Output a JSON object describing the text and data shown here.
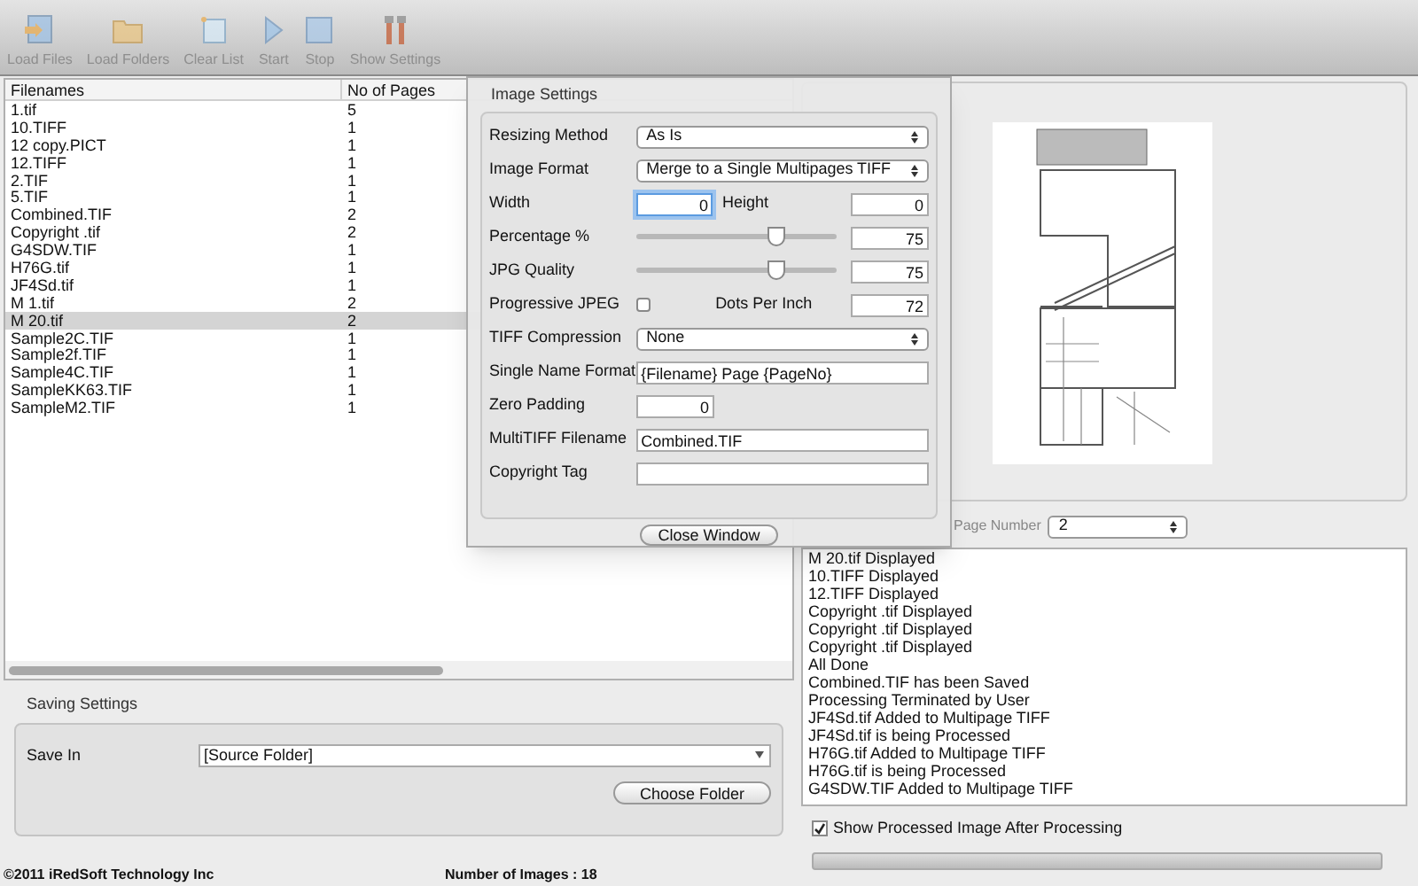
{
  "toolbar": [
    {
      "label": "Load Files",
      "kind": "load-files",
      "disabled": true
    },
    {
      "label": "Load Folders",
      "kind": "folder",
      "disabled": true
    },
    {
      "label": "Clear List",
      "kind": "clear",
      "disabled": true
    },
    {
      "label": "Start",
      "kind": "start",
      "disabled": true
    },
    {
      "label": "Stop",
      "kind": "stop",
      "disabled": true
    },
    {
      "label": "Show Settings",
      "kind": "tools",
      "disabled": true
    }
  ],
  "file_list": {
    "columns": [
      "Filenames",
      "No of Pages"
    ],
    "rows": [
      {
        "cells": [
          "1.tif",
          "5"
        ],
        "selected": false
      },
      {
        "cells": [
          "10.TIFF",
          "1"
        ],
        "selected": false
      },
      {
        "cells": [
          "12 copy.PICT",
          "1"
        ],
        "selected": false
      },
      {
        "cells": [
          "12.TIFF",
          "1"
        ],
        "selected": false
      },
      {
        "cells": [
          "2.TIF",
          "1"
        ],
        "selected": false
      },
      {
        "cells": [
          "5.TIF",
          "1"
        ],
        "selected": false
      },
      {
        "cells": [
          "Combined.TIF",
          "2"
        ],
        "selected": false
      },
      {
        "cells": [
          "Copyright .tif",
          "2"
        ],
        "selected": false
      },
      {
        "cells": [
          "G4SDW.TIF",
          "1"
        ],
        "selected": false
      },
      {
        "cells": [
          "H76G.tif",
          "1"
        ],
        "selected": false
      },
      {
        "cells": [
          "JF4Sd.tif",
          "1"
        ],
        "selected": false
      },
      {
        "cells": [
          "M 1.tif",
          "2"
        ],
        "selected": false
      },
      {
        "cells": [
          "M 20.tif",
          "2"
        ],
        "selected": true
      },
      {
        "cells": [
          "Sample2C.TIF",
          "1"
        ],
        "selected": false
      },
      {
        "cells": [
          "Sample2f.TIF",
          "1"
        ],
        "selected": false
      },
      {
        "cells": [
          "Sample4C.TIF",
          "1"
        ],
        "selected": false
      },
      {
        "cells": [
          "SampleKK63.TIF",
          "1"
        ],
        "selected": false
      },
      {
        "cells": [
          "SampleM2.TIF",
          "1"
        ],
        "selected": false
      }
    ]
  },
  "saving_settings": {
    "title": "Saving Settings",
    "save_in_label": "Save In",
    "save_in_value": "[Source Folder]",
    "choose_button": "Choose Folder"
  },
  "footer": {
    "copyright": "©2011 iRedSoft Technology Inc",
    "count": "Number of Images : 18"
  },
  "image_settings": {
    "title": "Image Settings",
    "rows": [
      {
        "kind": "select",
        "label": "Resizing Method",
        "value": "As Is"
      },
      {
        "kind": "select",
        "label": "Image Format",
        "value": "Merge to a Single Multipages TIFF"
      },
      {
        "kind": "pair",
        "label": "Width",
        "value": "0",
        "label2": "Height",
        "value2": "0",
        "focused": true
      },
      {
        "kind": "slider",
        "label": "Percentage %",
        "level": 0.72,
        "value": "75"
      },
      {
        "kind": "slider",
        "label": "JPG Quality",
        "level": 0.72,
        "value": "75"
      },
      {
        "kind": "check",
        "label": "Progressive JPEG",
        "checked": false,
        "label2": "Dots Per Inch",
        "value2": "72"
      },
      {
        "kind": "select",
        "label": "TIFF Compression",
        "value": "None"
      },
      {
        "kind": "text",
        "label": "Single Name Format",
        "value": "{Filename} Page {PageNo}"
      },
      {
        "kind": "short",
        "label": "Zero Padding",
        "value": "0"
      },
      {
        "kind": "text",
        "label": "MultiTIFF Filename",
        "value": "Combined.TIF"
      },
      {
        "kind": "text",
        "label": "Copyright Tag",
        "value": ""
      }
    ],
    "close_button": "Close Window"
  },
  "preview": {
    "page_number_label": "Page Number",
    "page_number": "2"
  },
  "log": [
    "M 20.tif Displayed",
    "10.TIFF Displayed",
    "12.TIFF Displayed",
    "Copyright .tif Displayed",
    "Copyright .tif Displayed",
    "Copyright .tif Displayed",
    "All Done",
    "Combined.TIF has been Saved",
    "Processing Terminated by User",
    "JF4Sd.tif Added to Multipage TIFF",
    "JF4Sd.tif is being Processed",
    "H76G.tif Added to Multipage TIFF",
    "H76G.tif is being Processed",
    "G4SDW.TIF Added to Multipage TIFF"
  ],
  "show_processed": {
    "label": "Show Processed Image After Processing",
    "checked": true
  },
  "progress": {
    "level": 0
  }
}
